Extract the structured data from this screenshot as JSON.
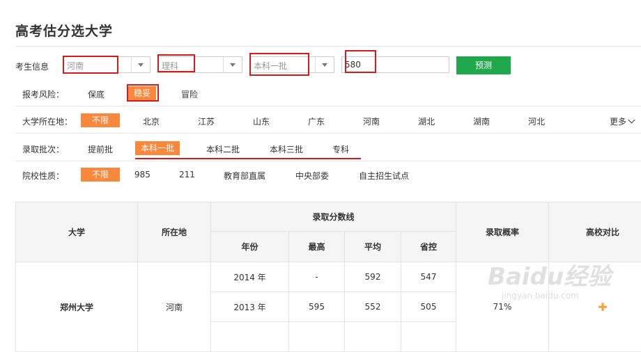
{
  "page": {
    "title": "高考估分选大学"
  },
  "form": {
    "label": "考生信息",
    "province": "河南",
    "track": "理科",
    "batch": "本科一批",
    "score": "580",
    "predict_label": "预测"
  },
  "risk": {
    "label": "报考风险：",
    "options": [
      "保底",
      "稳妥",
      "冒险"
    ]
  },
  "location": {
    "label": "大学所在地：",
    "options": [
      "不限",
      "北京",
      "江苏",
      "山东",
      "广东",
      "河南",
      "湖北",
      "湖南",
      "河北"
    ],
    "more_label": "更多"
  },
  "admission_batch": {
    "label": "录取批次：",
    "options": [
      "提前批",
      "本科一批",
      "本科二批",
      "本科三批",
      "专科"
    ]
  },
  "school_type": {
    "label": "院校性质：",
    "options": [
      "不限",
      "985",
      "211",
      "教育部直属",
      "中央部委",
      "自主招生试点"
    ]
  },
  "table": {
    "headers": {
      "university": "大学",
      "location": "所在地",
      "score_line": "录取分数线",
      "year": "年份",
      "max": "最高",
      "avg": "平均",
      "provincial": "省控",
      "probability": "录取概率",
      "compare": "高校对比"
    },
    "university": "郑州大学",
    "uni_location": "河南",
    "probability": "71%",
    "compare_icon": "plus-icon",
    "rows": [
      {
        "year": "2014 年",
        "max": "-",
        "avg": "592",
        "provincial": "547"
      },
      {
        "year": "2013 年",
        "max": "595",
        "avg": "552",
        "provincial": "505"
      }
    ]
  },
  "watermark": {
    "text": "Baidu经验",
    "url": "jingyan.baidu.com"
  },
  "colors": {
    "accent": "#f7883c",
    "predict_button": "#1fa84c",
    "annotation": "#d51a1a"
  }
}
